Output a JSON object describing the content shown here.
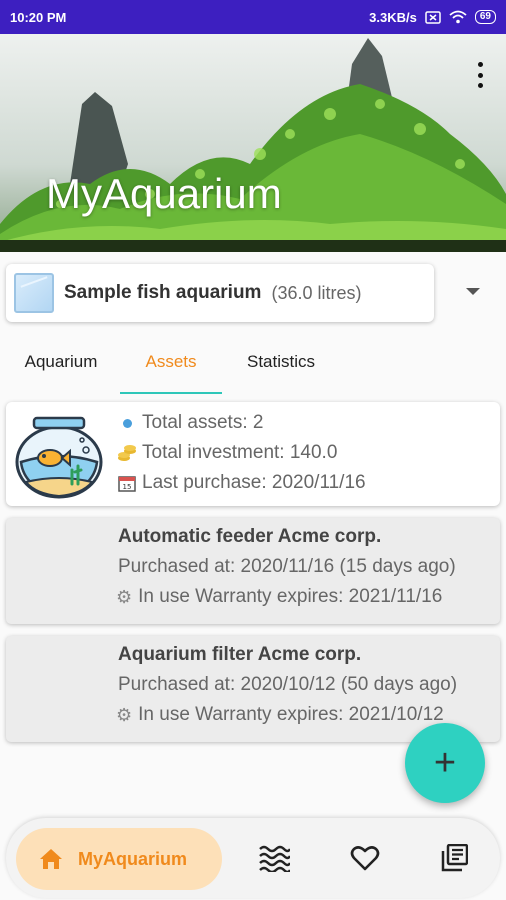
{
  "status_bar": {
    "time": "10:20 PM",
    "speed": "3.3KB/s",
    "battery": "69"
  },
  "header": {
    "title": "MyAquarium",
    "icons": [
      "more-vert-icon"
    ]
  },
  "aquarium_selector": {
    "name": "Sample fish aquarium",
    "volume": "(36.0 litres)",
    "icon": "tank-icon"
  },
  "tabs": [
    {
      "label": "Aquarium",
      "active": false
    },
    {
      "label": "Assets",
      "active": true
    },
    {
      "label": "Statistics",
      "active": false
    }
  ],
  "summary": {
    "total_assets": "Total assets: 2",
    "total_investment": "Total investment: 140.0",
    "last_purchase": "Last purchase: 2020/11/16"
  },
  "assets": [
    {
      "title": "Automatic feeder Acme corp.",
      "purchased": "Purchased at: 2020/11/16 (15 days ago)",
      "status": "In use Warranty expires: 2021/11/16"
    },
    {
      "title": "Aquarium filter Acme corp.",
      "purchased": "Purchased at: 2020/10/12 (50 days ago)",
      "status": "In use Warranty expires: 2021/10/12"
    }
  ],
  "fab": {
    "label": "+"
  },
  "bottom_nav": {
    "items": [
      {
        "label": "MyAquarium",
        "icon": "home-icon",
        "active": true
      },
      {
        "label": "",
        "icon": "waves-icon",
        "active": false
      },
      {
        "label": "",
        "icon": "heart-icon",
        "active": false
      },
      {
        "label": "",
        "icon": "library-icon",
        "active": false
      }
    ]
  },
  "colors": {
    "status_bar": "#3d1fc0",
    "accent_orange": "#f08a1c",
    "accent_teal": "#2ec7b9",
    "fab": "#2ed1c1"
  }
}
